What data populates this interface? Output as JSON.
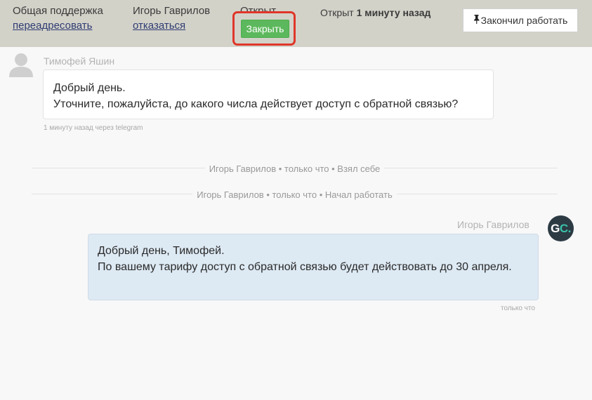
{
  "header": {
    "queue_name": "Общая поддержка",
    "queue_action": "переадресовать",
    "assignee_name": "Игорь Гаврилов",
    "assignee_action": "отказаться",
    "status_label": "Открыт",
    "close_button": "Закрыть",
    "opened_prefix": "Открыт",
    "opened_time": "1 минуту назад",
    "finish_button": "Закончил работать",
    "finish_icon": "pin-icon"
  },
  "messages": [
    {
      "author": "Тимофей Яшин",
      "line1": "Добрый день.",
      "line2": "Уточните, пожалуйста, до какого числа действует доступ с обратной связью?",
      "meta": "1 минуту назад через telegram",
      "avatar_icon": "user-silhouette-icon"
    },
    {
      "author": "Игорь Гаврилов",
      "line1": "Добрый день, Тимофей.",
      "line2": "По вашему тарифу доступ с обратной связью будет действовать до 30 апреля.",
      "meta": "только что",
      "avatar_text": "GC.",
      "avatar_letters": "G",
      "avatar_accent": "C."
    }
  ],
  "events": [
    "Игорь Гаврилов • только что • Взял себе",
    "Игорь Гаврилов • только что • Начал работать"
  ],
  "colors": {
    "topbar": "#d3d2c9",
    "close_button": "#5cb85c",
    "highlight": "#e0362a",
    "outgoing_bubble": "#dde9f3",
    "avatar_bg": "#2c3a44",
    "avatar_accent": "#3ac1a8"
  }
}
